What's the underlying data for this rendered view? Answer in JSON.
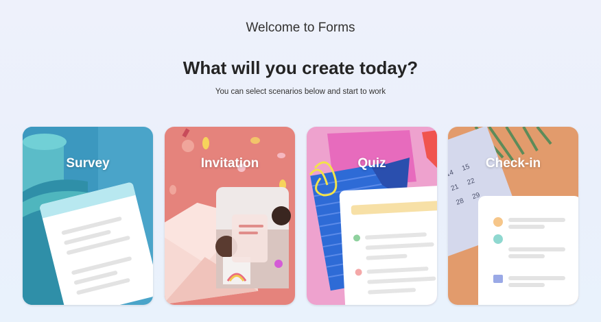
{
  "header": {
    "welcome": "Welcome to Forms",
    "headline": "What will you create today?",
    "subtitle": "You can select scenarios below and start to work"
  },
  "cards": [
    {
      "id": "survey",
      "title": "Survey"
    },
    {
      "id": "invitation",
      "title": "Invitation"
    },
    {
      "id": "quiz",
      "title": "Quiz"
    },
    {
      "id": "checkin",
      "title": "Check-in"
    }
  ],
  "checkin": {
    "calendar_days": [
      "14",
      "15",
      "21",
      "22",
      "28",
      "29"
    ]
  },
  "colors": {
    "survey_bg": "#4aa8c8",
    "invitation_bg": "#e4837c",
    "quiz_bg": "#ee9ec9",
    "checkin_bg": "#e09a6a",
    "quiz_banner": "#f7e0a6",
    "correct_green": "#8fd19e",
    "wrong_red": "#f4a8a8"
  }
}
